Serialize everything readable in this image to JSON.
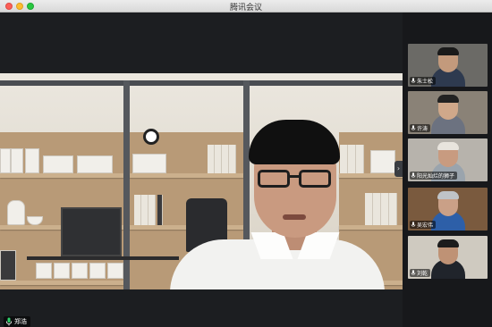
{
  "window": {
    "title": "腾讯会议"
  },
  "speaker": {
    "name": "郑浩"
  },
  "participants": [
    {
      "name": "朱士松",
      "bg": "#6b6a66",
      "face": "#c39a7c",
      "hair": "#1a1a1a",
      "shirt": "#2e3a4f"
    },
    {
      "name": "许涛",
      "bg": "#8a8277",
      "face": "#d0a88a",
      "hair": "#222222",
      "shirt": "#6c7280"
    },
    {
      "name": "阳光灿烂的狮子",
      "bg": "#b7b3ac",
      "face": "#c89b80",
      "hair": "#e8e4dd",
      "shirt": "#9aa4ad"
    },
    {
      "name": "吴宏伟",
      "bg": "#7a5a3e",
      "face": "#caa087",
      "hair": "#bfc3c7",
      "shirt": "#2d5fa8"
    },
    {
      "name": "刘乾",
      "bg": "#cfcac0",
      "face": "#bf9275",
      "hair": "#1c1c1c",
      "shirt": "#20242b"
    }
  ]
}
